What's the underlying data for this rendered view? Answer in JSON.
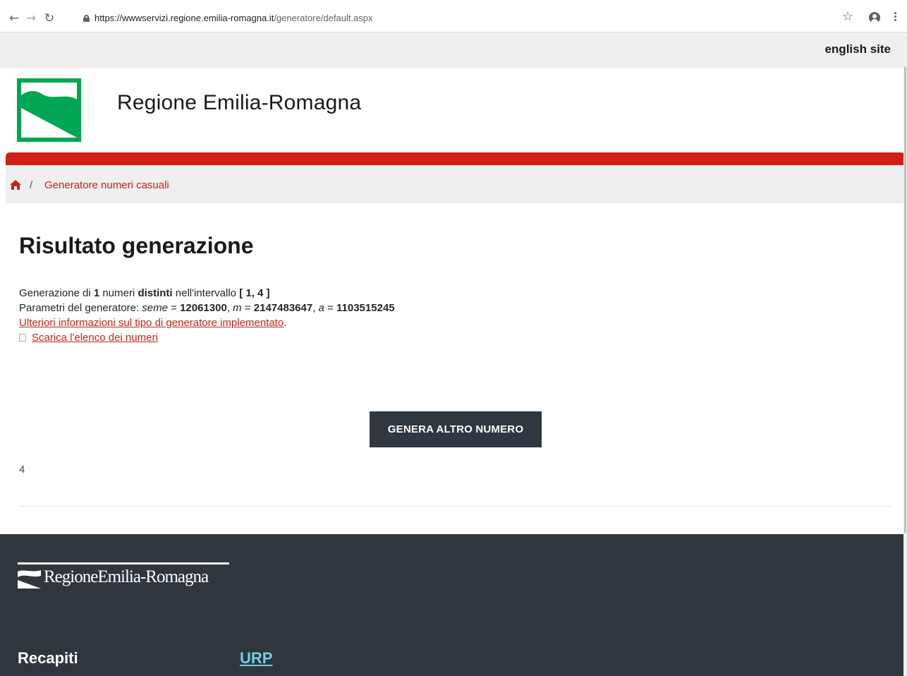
{
  "browser": {
    "url_host": "https://wwwservizi.regione.emilia-romagna.it",
    "url_path": "/generatore/default.aspx",
    "icons": [
      "back-icon",
      "forward-icon",
      "reload-icon",
      "lock-icon",
      "star-icon",
      "account-icon",
      "menu-icon"
    ]
  },
  "topbar": {
    "english_label": "english site"
  },
  "header": {
    "title": "Regione Emilia-Romagna"
  },
  "breadcrumb": {
    "separator": "/",
    "current": "Generatore numeri casuali"
  },
  "main": {
    "title": "Risultato generazione",
    "line1": {
      "pre": "Generazione di ",
      "count": "1",
      "mid1": " numeri ",
      "distinct": "distinti",
      "mid2": " nell'intervallo ",
      "interval": "[ 1, 4 ]"
    },
    "line2": {
      "pre": "Parametri del generatore: ",
      "seed_label": "seme",
      "eq1": " = ",
      "seed": "12061300",
      "sep1": ", ",
      "m_label": "m",
      "eq2": " = ",
      "m": "2147483647",
      "sep2": ", ",
      "a_label": "a",
      "eq3": " = ",
      "a": "1103515245"
    },
    "info_link": "Ulteriori informazioni sul tipo di generatore implementato",
    "info_link_suffix": ".",
    "download_link": "Scarica l'elenco dei numeri",
    "button_label": "GENERA ALTRO NUMERO",
    "result": "4"
  },
  "footer": {
    "logo_text": "RegioneEmilia-Romagna",
    "heading": "Recapiti",
    "link": "URP"
  },
  "colors": {
    "brand_red": "#d11f16",
    "link_red": "#c2241a",
    "logo_green": "#00a651",
    "footer_bg": "#30363d",
    "button_bg": "#2f3740",
    "footer_link": "#6fd0e0"
  }
}
